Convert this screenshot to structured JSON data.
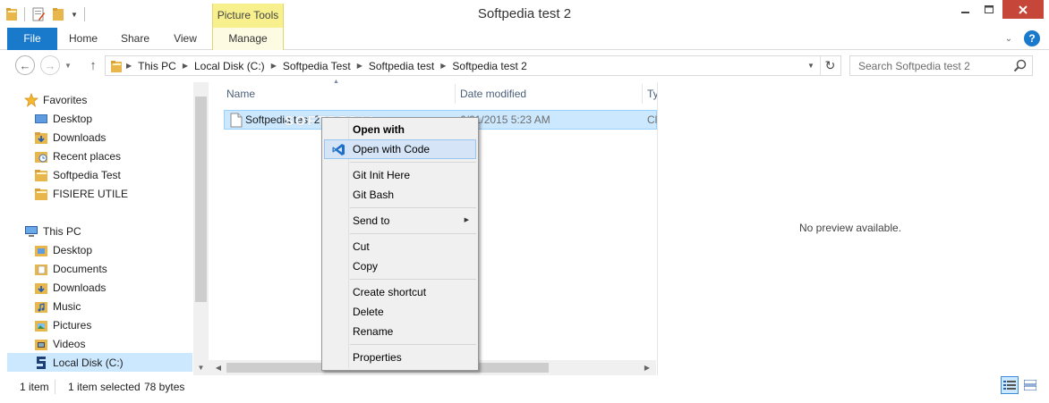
{
  "window": {
    "title": "Softpedia test 2",
    "context_tab_group": "Picture Tools"
  },
  "ribbon": {
    "tabs": [
      "File",
      "Home",
      "Share",
      "View",
      "Manage"
    ]
  },
  "address": {
    "crumbs": [
      "This PC",
      "Local Disk (C:)",
      "Softpedia Test",
      "Softpedia test",
      "Softpedia test 2"
    ]
  },
  "search": {
    "placeholder": "Search Softpedia test 2"
  },
  "navpane": {
    "favorites_label": "Favorites",
    "favorites": [
      "Desktop",
      "Downloads",
      "Recent places",
      "Softpedia Test",
      "FISIERE UTILE"
    ],
    "thispc_label": "This PC",
    "thispc": [
      "Desktop",
      "Documents",
      "Downloads",
      "Music",
      "Pictures",
      "Videos",
      "Local Disk (C:)"
    ]
  },
  "filelist": {
    "columns": {
      "name": "Name",
      "date": "Date modified",
      "type": "Ty"
    },
    "rows": [
      {
        "name": "Softpedia test 2.",
        "date": "6/21/2015 5:23 AM",
        "type": "Cl"
      }
    ],
    "watermark": "SOFTPEDIA"
  },
  "preview": {
    "message": "No preview available."
  },
  "status": {
    "count": "1 item",
    "selected": "1 item selected",
    "size": "78 bytes"
  },
  "context_menu": {
    "items": {
      "open_with": "Open with",
      "open_with_code": "Open with Code",
      "git_init": "Git Init Here",
      "git_bash": "Git Bash",
      "send_to": "Send to",
      "cut": "Cut",
      "copy": "Copy",
      "create_shortcut": "Create shortcut",
      "delete": "Delete",
      "rename": "Rename",
      "properties": "Properties"
    }
  },
  "colors": {
    "accent": "#1979ca",
    "selection": "#cce8ff",
    "context_tab": "#f8f08c",
    "close": "#c7463a"
  }
}
